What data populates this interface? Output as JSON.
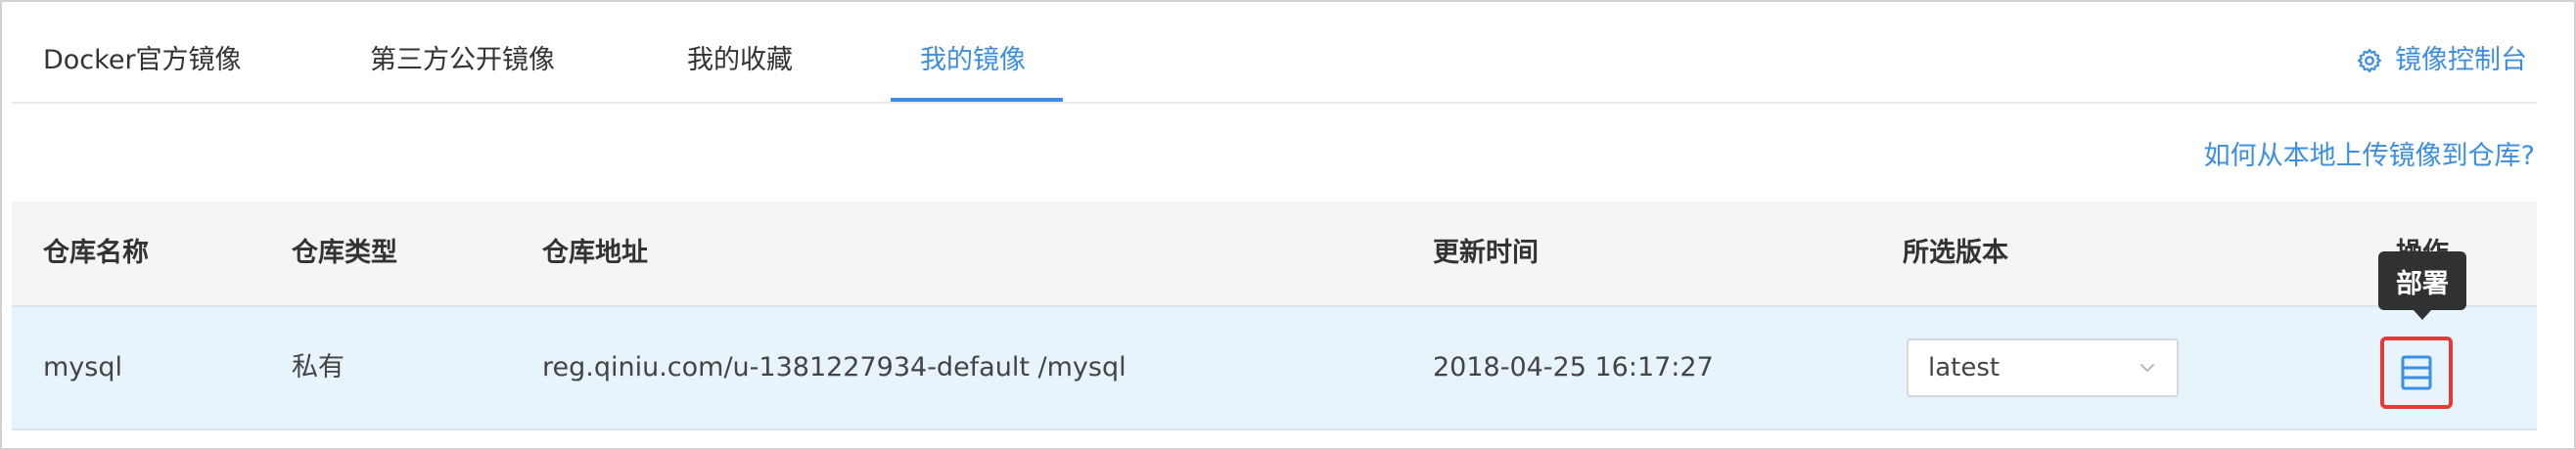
{
  "tabs": [
    {
      "label": "Docker官方镜像"
    },
    {
      "label": "第三方公开镜像"
    },
    {
      "label": "我的收藏"
    },
    {
      "label": "我的镜像"
    }
  ],
  "active_tab": "我的镜像",
  "console_link": {
    "label": "镜像控制台",
    "icon": "gear-icon"
  },
  "help_link": {
    "label": "如何从本地上传镜像到仓库?"
  },
  "table": {
    "columns": [
      "仓库名称",
      "仓库类型",
      "仓库地址",
      "更新时间",
      "所选版本",
      "操作"
    ],
    "rows": [
      {
        "name": "mysql",
        "type": "私有",
        "address": "reg.qiniu.com/u-1381227934-default /mysql",
        "updated": "2018-04-25 16:17:27",
        "version": "latest",
        "action_icon": "deploy-icon"
      }
    ]
  },
  "tooltip": {
    "label": "部署"
  },
  "colors": {
    "accent": "#3a8ee6",
    "row_highlight": "#e8f4fb",
    "header_bg": "#f5f5f5",
    "tooltip_bg": "#2f3133",
    "focus_ring": "#e53935"
  }
}
